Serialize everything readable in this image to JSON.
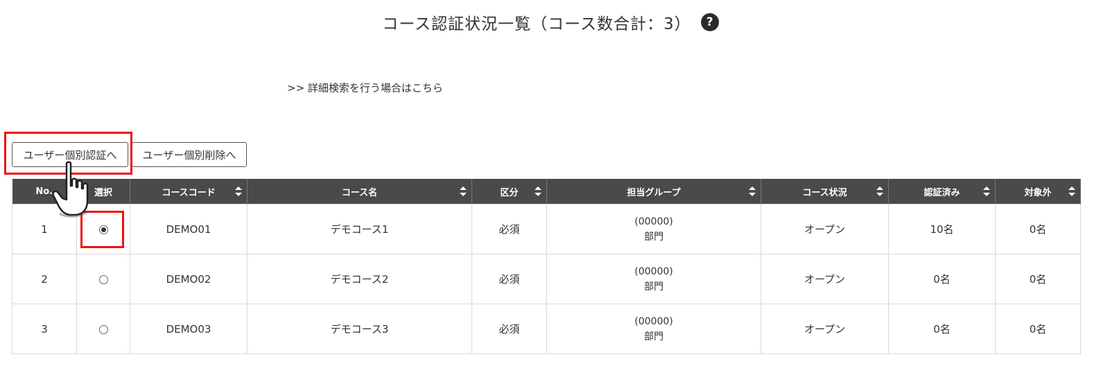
{
  "page": {
    "title": "コース認証状況一覧（コース数合計：3）",
    "help_icon": "question-circle-icon",
    "advanced_search_link": ">> 詳細検索を行う場合はこちら"
  },
  "actions": {
    "individual_auth_label": "ユーザー個別認証へ",
    "individual_delete_label": "ユーザー個別削除へ"
  },
  "table": {
    "headers": [
      "No.",
      "選択",
      "コースコード",
      "コース名",
      "区分",
      "担当グループ",
      "コース状況",
      "認証済み",
      "対象外"
    ],
    "sortable": [
      false,
      false,
      true,
      true,
      true,
      true,
      true,
      true,
      true
    ],
    "rows": [
      {
        "no": "1",
        "selected": true,
        "code": "DEMO01",
        "name": "デモコース1",
        "category": "必須",
        "group_code": "(00000)",
        "group_name": "部門",
        "status": "オープン",
        "certified": "10名",
        "excluded": "0名"
      },
      {
        "no": "2",
        "selected": false,
        "code": "DEMO02",
        "name": "デモコース2",
        "category": "必須",
        "group_code": "(00000)",
        "group_name": "部門",
        "status": "オープン",
        "certified": "0名",
        "excluded": "0名"
      },
      {
        "no": "3",
        "selected": false,
        "code": "DEMO03",
        "name": "デモコース3",
        "category": "必須",
        "group_code": "(00000)",
        "group_name": "部門",
        "status": "オープン",
        "certified": "0名",
        "excluded": "0名"
      }
    ]
  },
  "colors": {
    "header_bg": "#4a4a4a",
    "highlight": "#e11111"
  },
  "icons": {
    "sort": "sort-updown-icon",
    "cursor": "hand-pointer-icon"
  }
}
